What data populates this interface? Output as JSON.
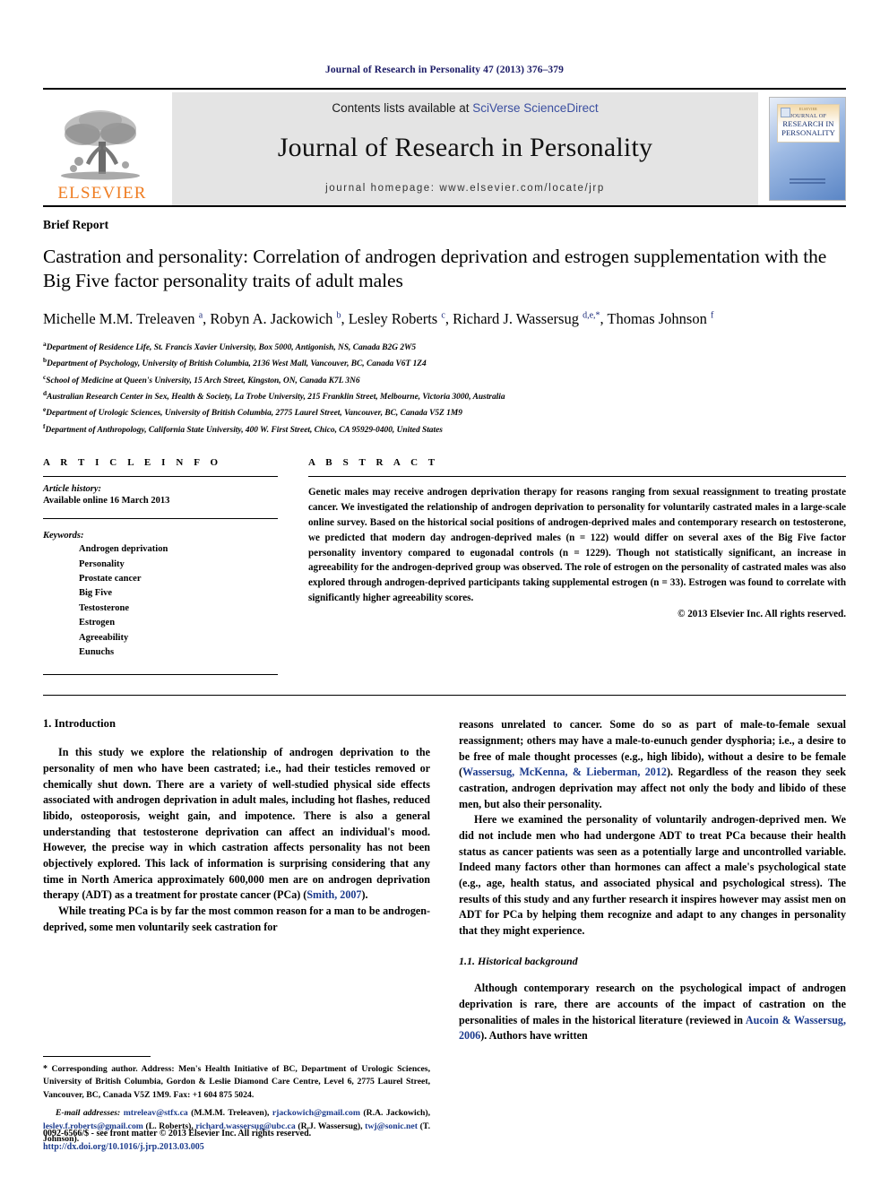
{
  "running_head": "Journal of Research in Personality 47 (2013) 376–379",
  "masthead": {
    "publisher_name": "ELSEVIER",
    "publisher_logo_icon": "elsevier-tree-icon",
    "contents_prefix": "Contents lists available at ",
    "contents_link": "SciVerse ScienceDirect",
    "journal_title": "Journal of Research in Personality",
    "homepage_label": "journal homepage: www.elsevier.com/locate/jrp",
    "cover": {
      "kicker": "ELSEVIER",
      "line1": "JOURNAL OF",
      "line2": "RESEARCH IN",
      "line3": "PERSONALITY"
    },
    "accent_orange": "#ef7d22",
    "link_blue": "#3b4fa0",
    "banner_gray": "#e4e4e4"
  },
  "article": {
    "type_label": "Brief Report",
    "title": "Castration and personality: Correlation of androgen deprivation and estrogen supplementation with the Big Five factor personality traits of adult males",
    "authors_html": "Michelle M.M. Treleaven <sup>a</sup>, Robyn A. Jackowich <sup>b</sup>, Lesley Roberts <sup>c</sup>, Richard J. Wassersug <sup>d,e,</sup><sup>*</sup>, Thomas Johnson <sup>f</sup>",
    "affiliations": [
      {
        "mark": "a",
        "text": "Department of Residence Life, St. Francis Xavier University, Box 5000, Antigonish, NS, Canada B2G 2W5"
      },
      {
        "mark": "b",
        "text": "Department of Psychology, University of British Columbia, 2136 West Mall, Vancouver, BC, Canada V6T 1Z4"
      },
      {
        "mark": "c",
        "text": "School of Medicine at Queen's University, 15 Arch Street, Kingston, ON, Canada K7L 3N6"
      },
      {
        "mark": "d",
        "text": "Australian Research Center in Sex, Health & Society, La Trobe University, 215 Franklin Street, Melbourne, Victoria 3000, Australia"
      },
      {
        "mark": "e",
        "text": "Department of Urologic Sciences, University of British Columbia, 2775 Laurel Street, Vancouver, BC, Canada V5Z 1M9"
      },
      {
        "mark": "f",
        "text": "Department of Anthropology, California State University, 400 W. First Street, Chico, CA 95929-0400, United States"
      }
    ]
  },
  "article_info": {
    "heading": "A R T I C L E  I N F O",
    "history_label": "Article history:",
    "history_value": "Available online 16 March 2013",
    "keywords_label": "Keywords:",
    "keywords": [
      "Androgen deprivation",
      "Personality",
      "Prostate cancer",
      "Big Five",
      "Testosterone",
      "Estrogen",
      "Agreeability",
      "Eunuchs"
    ]
  },
  "abstract": {
    "heading": "A B S T R A C T",
    "body": "Genetic males may receive androgen deprivation therapy for reasons ranging from sexual reassignment to treating prostate cancer. We investigated the relationship of androgen deprivation to personality for voluntarily castrated males in a large-scale online survey. Based on the historical social positions of androgen-deprived males and contemporary research on testosterone, we predicted that modern day androgen-deprived males (n = 122) would differ on several axes of the Big Five factor personality inventory compared to eugonadal controls (n = 1229). Though not statistically significant, an increase in agreeability for the androgen-deprived group was observed. The role of estrogen on the personality of castrated males was also explored through androgen-deprived participants taking supplemental estrogen (n = 33). Estrogen was found to correlate with significantly higher agreeability scores.",
    "copyright": "© 2013 Elsevier Inc. All rights reserved."
  },
  "sections": {
    "intro_heading": "1. Introduction",
    "intro_p1": "In this study we explore the relationship of androgen deprivation to the personality of men who have been castrated; i.e., had their testicles removed or chemically shut down. There are a variety of well-studied physical side effects associated with androgen deprivation in adult males, including hot flashes, reduced libido, osteoporosis, weight gain, and impotence. There is also a general understanding that testosterone deprivation can affect an individual's mood. However, the precise way in which castration affects personality has not been objectively explored. This lack of information is surprising considering that any time in North America approximately 600,000 men are on androgen deprivation therapy (ADT) as a treatment for prostate cancer (PCa) (",
    "intro_p1_cite": "Smith, 2007",
    "intro_p1_end": ").",
    "intro_p2_start": "While treating PCa is by far the most common reason for a man to be androgen-deprived, some men voluntarily seek castration for",
    "right_p1_start": "reasons unrelated to cancer. Some do so as part of male-to-female sexual reassignment; others may have a male-to-eunuch gender dysphoria; i.e., a desire to be free of male thought processes (e.g., high libido), without a desire to be female (",
    "right_p1_cite": "Wassersug, McKenna, & Lieberman, 2012",
    "right_p1_end": "). Regardless of the reason they seek castration, androgen deprivation may affect not only the body and libido of these men, but also their personality.",
    "right_p2": "Here we examined the personality of voluntarily androgen-deprived men. We did not include men who had undergone ADT to treat PCa because their health status as cancer patients was seen as a potentially large and uncontrolled variable. Indeed many factors other than hormones can affect a male's psychological state (e.g., age, health status, and associated physical and psychological stress). The results of this study and any further research it inspires however may assist men on ADT for PCa by helping them recognize and adapt to any changes in personality that they might experience.",
    "hist_heading": "1.1. Historical background",
    "hist_p_start": "Although contemporary research on the psychological impact of androgen deprivation is rare, there are accounts of the impact of castration on the personalities of males in the historical literature (reviewed in ",
    "hist_p_cite": "Aucoin & Wassersug, 2006",
    "hist_p_end": "). Authors have written"
  },
  "footnotes": {
    "corresponding_marker": "*",
    "corresponding_text": " Corresponding author. Address: Men's Health Initiative of BC, Department of Urologic Sciences, University of British Columbia, Gordon & Leslie Diamond Care Centre, Level 6, 2775 Laurel Street, Vancouver, BC, Canada V5Z 1M9. Fax: +1 604 875 5024.",
    "email_label": "E-mail addresses:",
    "emails": [
      {
        "address": "mtreleav@stfx.ca",
        "owner": "(M.M.M. Treleaven),"
      },
      {
        "address": "rjackowich@gmail.com",
        "owner": "(R.A. Jackowich),"
      },
      {
        "address": "lesley.f.roberts@gmail.com",
        "owner": "(L. Roberts),"
      },
      {
        "address": "richard.wassersug@ubc.ca",
        "owner": "(R.J. Wassersug),"
      },
      {
        "address": "twj@sonic.net",
        "owner": "(T. Johnson)."
      }
    ],
    "issn_line": "0092-6566/$ - see front matter © 2013 Elsevier Inc. All rights reserved.",
    "doi_line": "http://dx.doi.org/10.1016/j.jrp.2013.03.005"
  }
}
